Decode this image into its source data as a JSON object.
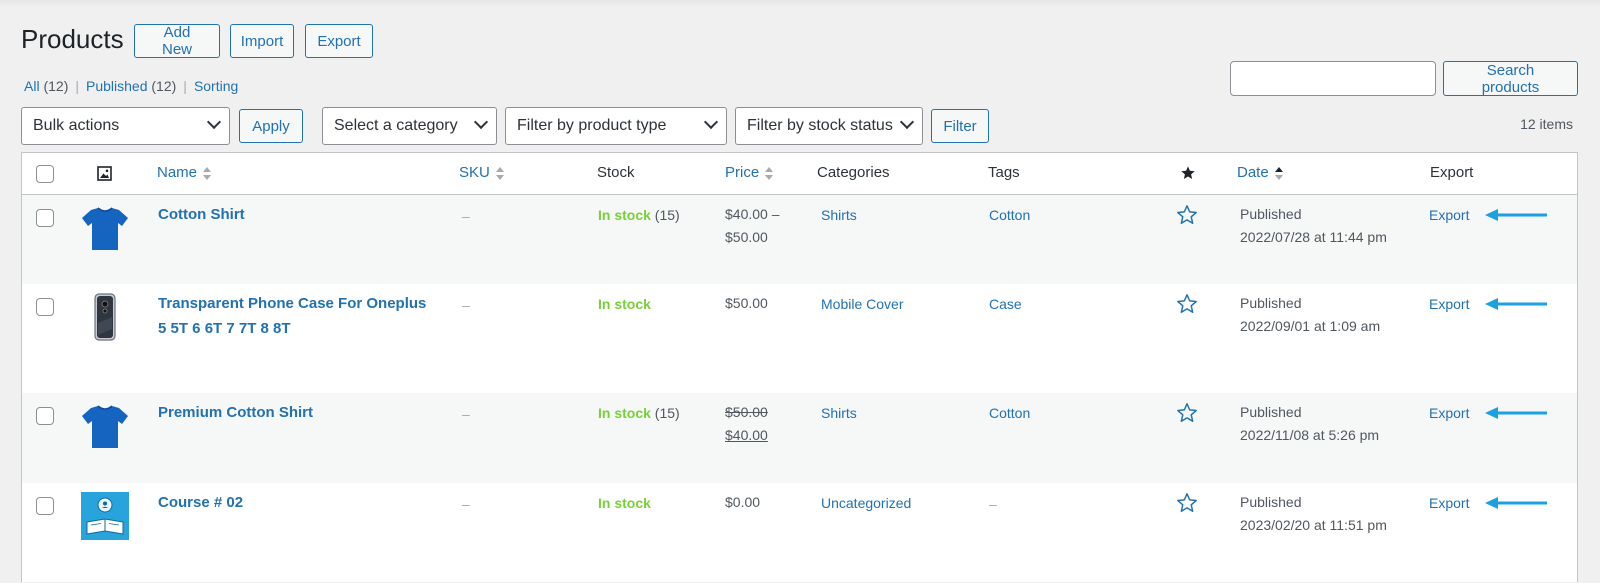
{
  "header": {
    "title": "Products",
    "buttons": {
      "add_new": "Add New",
      "import": "Import",
      "export": "Export"
    }
  },
  "views": [
    {
      "label": "All",
      "count": "(12)"
    },
    {
      "label": "Published",
      "count": "(12)"
    },
    {
      "label": "Sorting",
      "count": ""
    }
  ],
  "search": {
    "button": "Search products",
    "value": ""
  },
  "filters": {
    "bulk_actions": "Bulk actions",
    "apply": "Apply",
    "category": "Select a category",
    "product_type": "Filter by product type",
    "stock_status": "Filter by stock status",
    "filter": "Filter"
  },
  "items_count": "12 items",
  "columns": {
    "name": "Name",
    "sku": "SKU",
    "stock": "Stock",
    "price": "Price",
    "categories": "Categories",
    "tags": "Tags",
    "date": "Date",
    "export": "Export"
  },
  "rows": [
    {
      "thumb": "blue-shirt",
      "name_line1": "Cotton Shirt",
      "name_line2": "",
      "sku": "–",
      "stock_status": "In stock",
      "stock_qty": "(15)",
      "price_line1": "$40.00 –",
      "price_line2": "$50.00",
      "category": "Shirts",
      "tag": "Cotton",
      "status": "Published",
      "date": "2022/07/28 at 11:44 pm",
      "export": "Export"
    },
    {
      "thumb": "phone-case",
      "name_line1": "Transparent Phone Case For Oneplus",
      "name_line2": "5 5T 6 6T 7 7T 8 8T",
      "sku": "–",
      "stock_status": "In stock",
      "stock_qty": "",
      "price_line1": "$50.00",
      "price_line2": "",
      "category": "Mobile Cover",
      "tag": "Case",
      "status": "Published",
      "date": "2022/09/01 at 1:09 am",
      "export": "Export"
    },
    {
      "thumb": "blue-shirt",
      "name_line1": "Premium Cotton Shirt",
      "name_line2": "",
      "sku": "–",
      "stock_status": "In stock",
      "stock_qty": "(15)",
      "price_line1": "$50.00",
      "price_line2": "$40.00",
      "category": "Shirts",
      "tag": "Cotton",
      "status": "Published",
      "date": "2022/11/08 at 5:26 pm",
      "export": "Export"
    },
    {
      "thumb": "course",
      "name_line1": "Course # 02",
      "name_line2": "",
      "sku": "–",
      "stock_status": "In stock",
      "stock_qty": "",
      "price_line1": "$0.00",
      "price_line2": "",
      "category": "Uncategorized",
      "tag": "–",
      "status": "Published",
      "date": "2023/02/20 at 11:51 pm",
      "export": "Export"
    }
  ],
  "colors": {
    "accent": "#2271b1",
    "in_stock": "#7ad03a",
    "arrow": "#1ba1e2",
    "shirt": "#1565c0"
  }
}
